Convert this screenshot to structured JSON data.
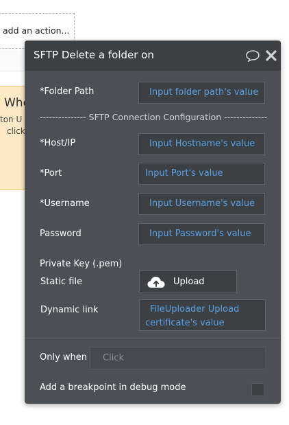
{
  "background": {
    "action_placeholder": "add an action...",
    "event_title": "Whe",
    "event_line1": "ton U",
    "event_line2": "click"
  },
  "panel": {
    "title": "SFTP Delete a folder on S",
    "folder_path": {
      "label": "*Folder Path",
      "value": "Input folder path's value"
    },
    "section_heading": "--------------- SFTP Connection Configuration --------------",
    "host": {
      "label": "*Host/IP",
      "value": "Input Hostname's value"
    },
    "port": {
      "label": "*Port",
      "value": "Input Port's value"
    },
    "username": {
      "label": "*Username",
      "value": "Input Username's value"
    },
    "password": {
      "label": "Password",
      "value": "Input Password's value"
    },
    "private_key_label": "Private Key (.pem)",
    "static_file": {
      "label": "Static file",
      "button": "Upload"
    },
    "dynamic_link": {
      "label": "Dynamic link",
      "value_line1": "FileUploader Upload",
      "value_line2": "certificate's value"
    },
    "only_when": {
      "label": "Only when",
      "placeholder": "Click"
    },
    "breakpoint": {
      "label": "Add a breakpoint in debug mode",
      "checked": false
    }
  },
  "colors": {
    "panel_bg": "#4c5054",
    "titlebar_bg": "#3c4043",
    "field_bg": "#3c4043",
    "link_blue": "#5aa0e6",
    "event_bg": "#fde9c6"
  },
  "icons": {
    "comment": "speech-bubble",
    "close": "x-mark",
    "upload": "cloud-upload"
  }
}
